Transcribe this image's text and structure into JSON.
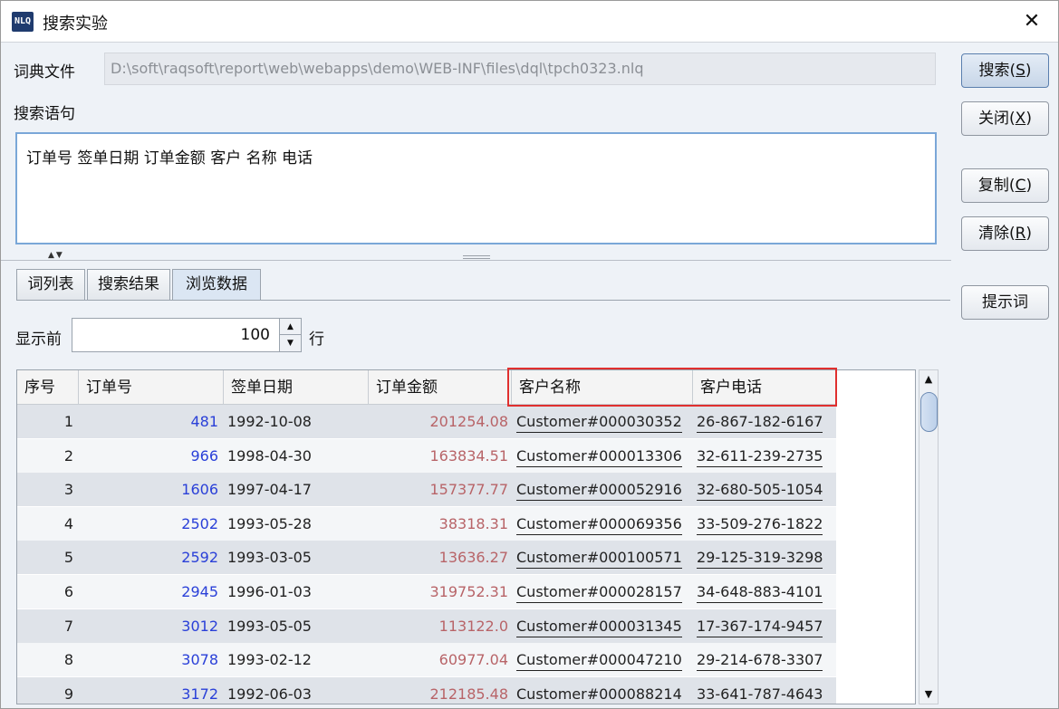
{
  "window": {
    "title": "搜索实验",
    "icon_text": "NLQ"
  },
  "dict": {
    "label": "词典文件",
    "path": "D:\\soft\\raqsoft\\report\\web\\webapps\\demo\\WEB-INF\\files\\dql\\tpch0323.nlq"
  },
  "query": {
    "label": "搜索语句",
    "text": "订单号 签单日期 订单金额 客户 名称 电话"
  },
  "buttons": {
    "search": "搜索(",
    "search_key": "S",
    "close": "关闭(",
    "close_key": "X",
    "copy": "复制(",
    "copy_key": "C",
    "clear": "清除(",
    "clear_key": "R",
    "hint": "提示词"
  },
  "tabs": [
    "词列表",
    "搜索结果",
    "浏览数据"
  ],
  "active_tab": "浏览数据",
  "show": {
    "label_before": "显示前",
    "count": "100",
    "label_after": "行"
  },
  "table": {
    "columns": [
      "序号",
      "订单号",
      "签单日期",
      "订单金额",
      "客户名称",
      "客户电话"
    ],
    "rows": [
      [
        "1",
        "481",
        "1992-10-08",
        "201254.08",
        "Customer#000030352",
        "26-867-182-6167"
      ],
      [
        "2",
        "966",
        "1998-04-30",
        "163834.51",
        "Customer#000013306",
        "32-611-239-2735"
      ],
      [
        "3",
        "1606",
        "1997-04-17",
        "157377.77",
        "Customer#000052916",
        "32-680-505-1054"
      ],
      [
        "4",
        "2502",
        "1993-05-28",
        "38318.31",
        "Customer#000069356",
        "33-509-276-1822"
      ],
      [
        "5",
        "2592",
        "1993-03-05",
        "13636.27",
        "Customer#000100571",
        "29-125-319-3298"
      ],
      [
        "6",
        "2945",
        "1996-01-03",
        "319752.31",
        "Customer#000028157",
        "34-648-883-4101"
      ],
      [
        "7",
        "3012",
        "1993-05-05",
        "113122.0",
        "Customer#000031345",
        "17-367-174-9457"
      ],
      [
        "8",
        "3078",
        "1993-02-12",
        "60977.04",
        "Customer#000047210",
        "29-214-678-3307"
      ],
      [
        "9",
        "3172",
        "1992-06-03",
        "212185.48",
        "Customer#000088214",
        "33-641-787-4643"
      ]
    ]
  },
  "icons": {
    "close": "close-icon",
    "spin_up": "triangle-up",
    "spin_down": "triangle-down"
  }
}
